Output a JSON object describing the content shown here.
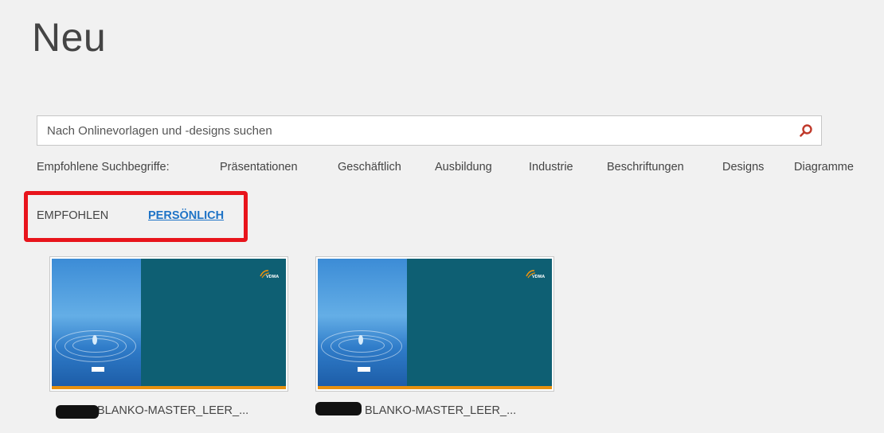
{
  "page": {
    "title": "Neu"
  },
  "search": {
    "placeholder": "Nach Onlinevorlagen und -designs suchen",
    "value": ""
  },
  "suggested_searches": {
    "label": "Empfohlene Suchbegriffe:",
    "items": [
      "Präsentationen",
      "Geschäftlich",
      "Ausbildung",
      "Industrie",
      "Beschriftungen",
      "Designs",
      "Diagramme"
    ]
  },
  "tabs": [
    {
      "label": "EMPFOHLEN",
      "active": false
    },
    {
      "label": "PERSÖNLICH",
      "active": true
    }
  ],
  "templates": [
    {
      "name": "BLANKO-MASTER_LEER_...",
      "logo_text": "VDMA"
    },
    {
      "name": "BLANKO-MASTER_LEER_...",
      "logo_text": "VDMA"
    }
  ],
  "colors": {
    "accent": "#1e73c6",
    "highlight": "#e8141c",
    "search_icon": "#c0392b",
    "slide_teal": "#0e5f73",
    "slide_bar": "#e8910f"
  },
  "icons": {
    "search": "magnifier-icon"
  }
}
